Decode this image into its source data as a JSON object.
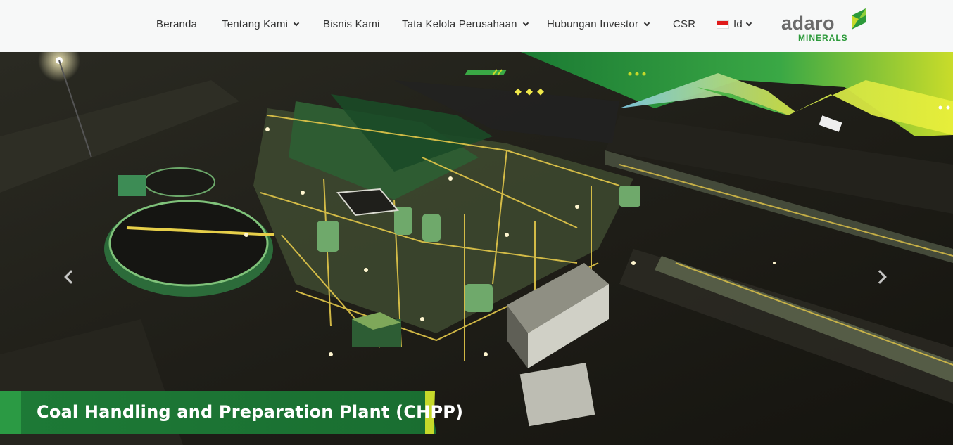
{
  "nav": {
    "items": [
      {
        "label": "Beranda",
        "dropdown": false
      },
      {
        "label": "Tentang Kami",
        "dropdown": true
      },
      {
        "label": "Bisnis Kami",
        "dropdown": false
      },
      {
        "label": "Tata Kelola Perusahaan",
        "dropdown": true
      },
      {
        "label": "Hubungan Investor",
        "dropdown": true
      },
      {
        "label": "CSR",
        "dropdown": false
      }
    ],
    "language": {
      "label": "Id",
      "flag_icon": "indonesia-flag-icon"
    }
  },
  "logo": {
    "word": "adaro",
    "sub": "MINERALS",
    "brand_green": "#2c9a3a"
  },
  "hero": {
    "caption": "Coal Handling and Preparation Plant (CHPP)",
    "prev_icon": "chevron-left-icon",
    "next_icon": "chevron-right-icon"
  },
  "colors": {
    "accent_green": "#1f8a3b",
    "lime": "#c6d92a",
    "nav_bg": "#f7f8f8"
  }
}
